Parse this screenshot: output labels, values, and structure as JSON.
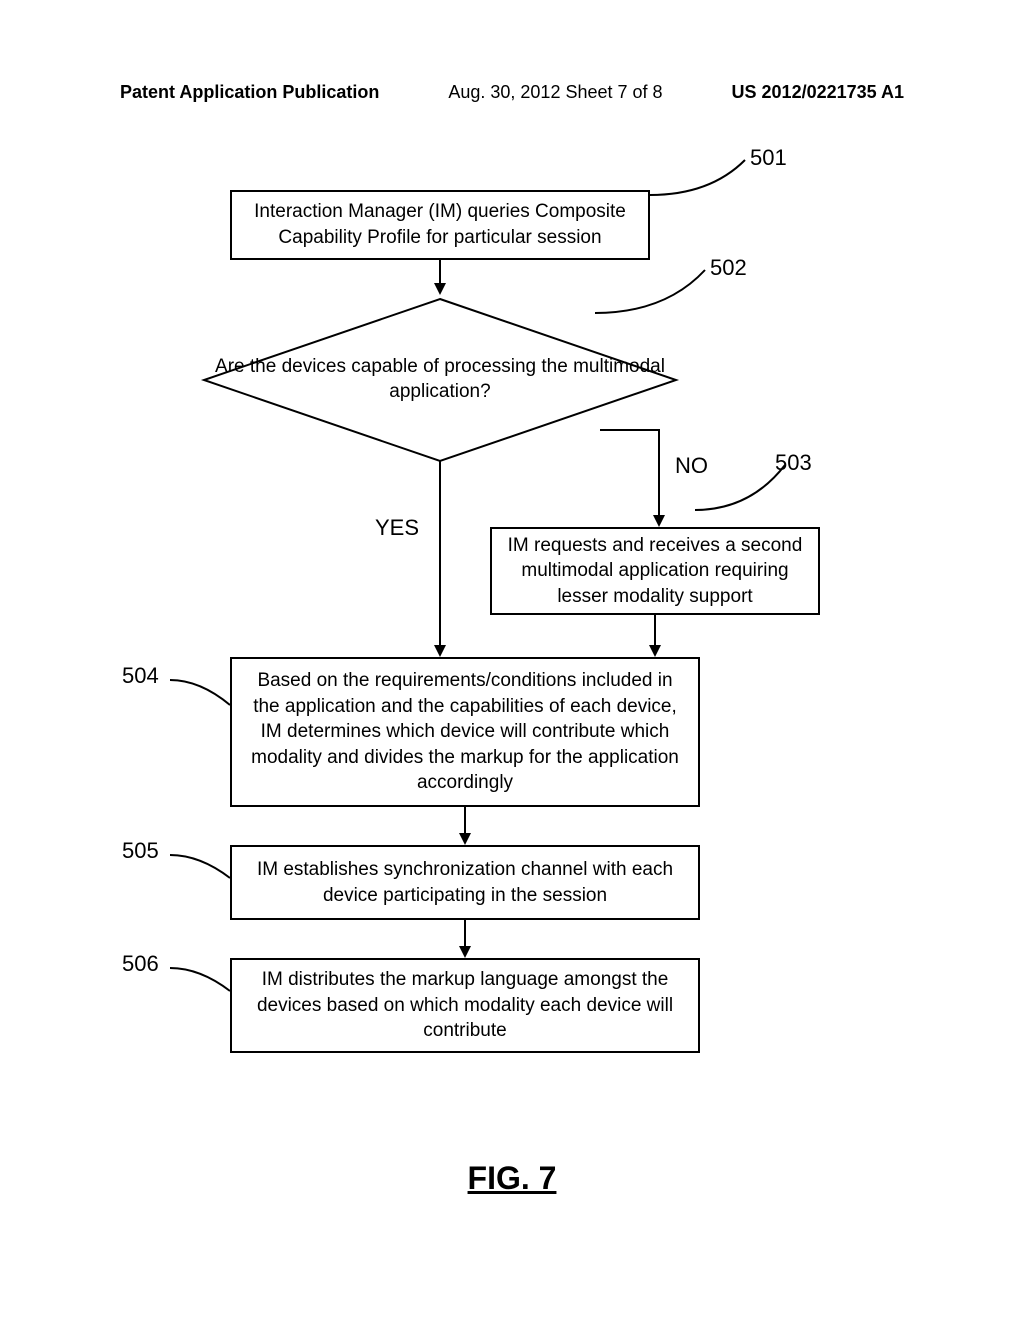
{
  "header": {
    "left": "Patent Application Publication",
    "center": "Aug. 30, 2012  Sheet 7 of 8",
    "right": "US 2012/0221735 A1"
  },
  "boxes": {
    "b501": "Interaction Manager (IM) queries Composite Capability Profile for particular session",
    "b502": "Are the devices capable of processing the multimodal application?",
    "b503": "IM requests and receives a second multimodal application requiring lesser modality support",
    "b504": "Based on the requirements/conditions included in the application and the capabilities of each device, IM determines which device will contribute which modality and divides the markup for the application accordingly",
    "b505": "IM establishes synchronization channel with each device participating in the session",
    "b506": "IM distributes the markup language amongst the devices based on which modality each device will contribute"
  },
  "labels": {
    "yes": "YES",
    "no": "NO"
  },
  "refs": {
    "r501": "501",
    "r502": "502",
    "r503": "503",
    "r504": "504",
    "r505": "505",
    "r506": "506"
  },
  "figure": "FIG. 7"
}
